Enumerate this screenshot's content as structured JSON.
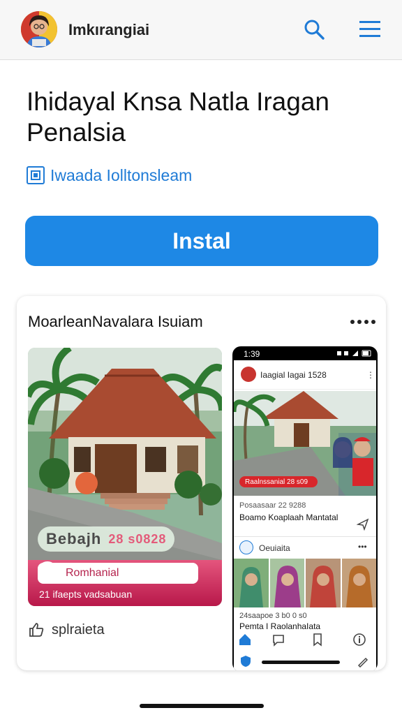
{
  "header": {
    "app_name": "Imkırangiai",
    "avatar_icon": "profile-avatar-icon",
    "search_icon": "search-icon",
    "menu_icon": "hamburger-menu-icon"
  },
  "listing": {
    "title": "Ihidayal Knsa Natla Iragan Penalsia",
    "developer": "Iwaada Iolltonsleam",
    "developer_icon": "app-icon",
    "install_label": "Instal"
  },
  "preview_card": {
    "title": "MoarleanNavalara Isuiam",
    "more_icon": "more-horizontal-icon",
    "screenshot1": {
      "banner_text": "Bebajh",
      "banner_accent": "28 s0828",
      "profile_label": "Romhanial",
      "footer_text": "21 ifaepts vadsabuan"
    },
    "like_label": "splraieta",
    "like_icon": "thumbs-up-icon",
    "phone": {
      "status_time": "1:39",
      "app_name": "Iaagial Iagai 1528",
      "chip_text": "Raalnssanial 28 s09",
      "post_meta": "Posaasaar 22 9288",
      "post_title": "Boamo Koaplaah Mantatal",
      "section_title": "Oeuiaita",
      "caption1": "24saapoe 3 b0 0 s0",
      "caption2": "Pemta I RaolanhaIata"
    }
  },
  "colors": {
    "accent": "#1e88e5",
    "link": "#1f7bd6",
    "pink": "#d83a66"
  }
}
